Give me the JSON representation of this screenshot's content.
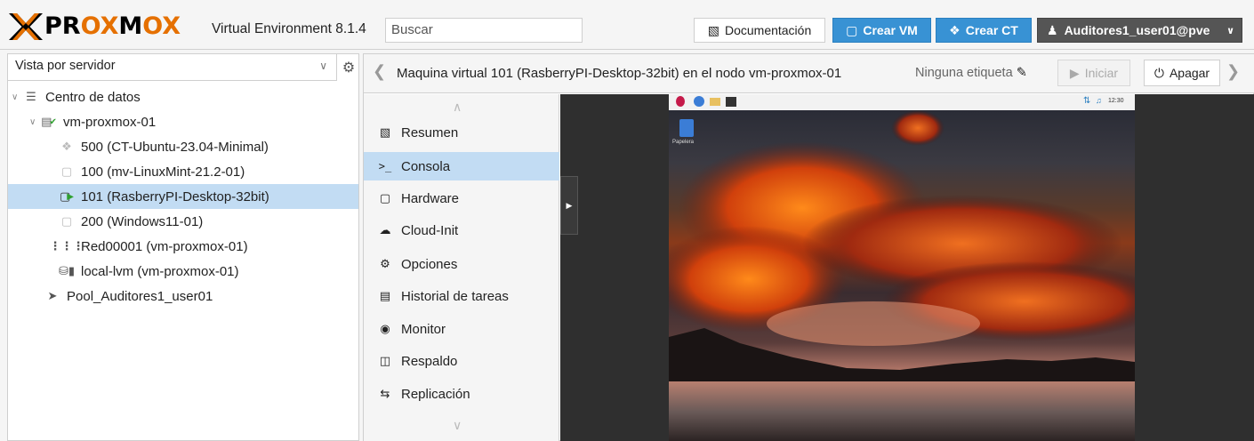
{
  "header": {
    "brand": "PROXMOX",
    "version": "Virtual Environment 8.1.4",
    "search_placeholder": "Buscar",
    "doc_label": "Documentación",
    "create_vm_label": "Crear VM",
    "create_ct_label": "Crear CT",
    "user_label": "Auditores1_user01@pve"
  },
  "left_panel": {
    "view_label": "Vista por servidor",
    "tree": [
      {
        "label": "Centro de datos",
        "icon": "datacenter-icon"
      },
      {
        "label": "vm-proxmox-01",
        "icon": "node-online-icon"
      },
      {
        "label": "500 (CT-Ubuntu-23.04-Minimal)",
        "icon": "container-icon"
      },
      {
        "label": "100 (mv-LinuxMint-21.2-01)",
        "icon": "vm-stopped-icon"
      },
      {
        "label": "101 (RasberryPI-Desktop-32bit)",
        "icon": "vm-running-icon"
      },
      {
        "label": "200 (Windows11-01)",
        "icon": "vm-stopped-icon"
      },
      {
        "label": "Red00001 (vm-proxmox-01)",
        "icon": "network-icon"
      },
      {
        "label": "local-lvm (vm-proxmox-01)",
        "icon": "storage-icon"
      },
      {
        "label": "Pool_Auditores1_user01",
        "icon": "pool-tags-icon"
      }
    ]
  },
  "content": {
    "vm_title": "Maquina virtual 101 (RasberryPI-Desktop-32bit) en el nodo vm-proxmox-01",
    "tags_label": "Ninguna etiqueta",
    "start_label": "Iniciar",
    "stop_label": "Apagar",
    "menu": [
      {
        "label": "Resumen",
        "icon": "book-icon"
      },
      {
        "label": "Consola",
        "icon": "terminal-icon"
      },
      {
        "label": "Hardware",
        "icon": "desktop-icon"
      },
      {
        "label": "Cloud-Init",
        "icon": "cloud-icon"
      },
      {
        "label": "Opciones",
        "icon": "gear-icon"
      },
      {
        "label": "Historial de tareas",
        "icon": "list-icon"
      },
      {
        "label": "Monitor",
        "icon": "eye-icon"
      },
      {
        "label": "Respaldo",
        "icon": "floppy-icon"
      },
      {
        "label": "Replicación",
        "icon": "retweet-icon"
      }
    ],
    "console": {
      "clock": "12:30",
      "desktop_icon_label": "Papelera"
    }
  },
  "colors": {
    "accent_blue": "#3892d4",
    "brand_orange": "#e57000",
    "selected_row": "#c2dcf3",
    "user_button": "#555555"
  }
}
